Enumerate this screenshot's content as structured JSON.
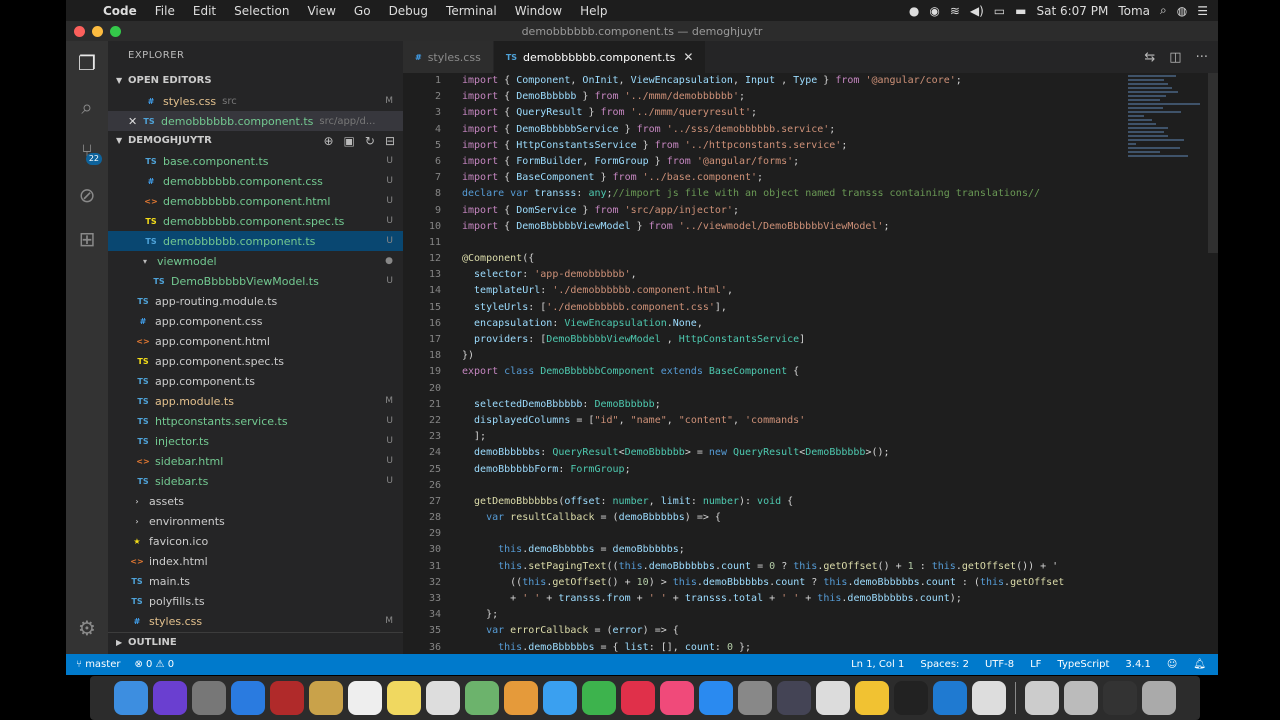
{
  "menubar": {
    "apple": "",
    "items": [
      "Code",
      "File",
      "Edit",
      "Selection",
      "View",
      "Go",
      "Debug",
      "Terminal",
      "Window",
      "Help"
    ],
    "clock": "Sat 6:07 PM",
    "user": "Toma"
  },
  "window": {
    "title": "demobbbbbb.component.ts — demoghjuytr"
  },
  "activity": {
    "scm_badge": "22"
  },
  "explorer": {
    "title": "EXPLORER",
    "open_editors_label": "OPEN EDITORS",
    "open_editors": [
      {
        "icon": "#",
        "name": "styles.css",
        "path": "src",
        "status": "M"
      },
      {
        "icon": "TS",
        "name": "demobbbbbb.component.ts",
        "path": "src/app/d...",
        "status": "U"
      }
    ],
    "project_label": "DEMOGHJUYTR",
    "files": [
      {
        "icon": "TS",
        "name": "base.component.ts",
        "status": "U"
      },
      {
        "icon": "#",
        "name": "demobbbbbb.component.css",
        "status": "U"
      },
      {
        "icon": "<>",
        "name": "demobbbbbb.component.html",
        "status": "U"
      },
      {
        "icon": "TS",
        "name": "demobbbbbb.component.spec.ts",
        "status": "U"
      },
      {
        "icon": "TS",
        "name": "demobbbbbb.component.ts",
        "status": "U"
      },
      {
        "icon": "▾",
        "name": "viewmodel",
        "status": "●"
      },
      {
        "icon": "TS",
        "name": "DemoBbbbbbViewModel.ts",
        "status": "U"
      },
      {
        "icon": "TS",
        "name": "app-routing.module.ts",
        "status": ""
      },
      {
        "icon": "#",
        "name": "app.component.css",
        "status": ""
      },
      {
        "icon": "<>",
        "name": "app.component.html",
        "status": ""
      },
      {
        "icon": "TS",
        "name": "app.component.spec.ts",
        "status": ""
      },
      {
        "icon": "TS",
        "name": "app.component.ts",
        "status": ""
      },
      {
        "icon": "TS",
        "name": "app.module.ts",
        "status": "M"
      },
      {
        "icon": "TS",
        "name": "httpconstants.service.ts",
        "status": "U"
      },
      {
        "icon": "TS",
        "name": "injector.ts",
        "status": "U"
      },
      {
        "icon": "<>",
        "name": "sidebar.html",
        "status": "U"
      },
      {
        "icon": "TS",
        "name": "sidebar.ts",
        "status": "U"
      },
      {
        "icon": "›",
        "name": "assets",
        "status": ""
      },
      {
        "icon": "›",
        "name": "environments",
        "status": ""
      },
      {
        "icon": "★",
        "name": "favicon.ico",
        "status": ""
      },
      {
        "icon": "<>",
        "name": "index.html",
        "status": ""
      },
      {
        "icon": "TS",
        "name": "main.ts",
        "status": ""
      },
      {
        "icon": "TS",
        "name": "polyfills.ts",
        "status": ""
      },
      {
        "icon": "#",
        "name": "styles.css",
        "status": "M"
      }
    ],
    "outline_label": "OUTLINE"
  },
  "tabs": [
    {
      "icon": "#",
      "label": "styles.css"
    },
    {
      "icon": "TS",
      "label": "demobbbbbb.component.ts"
    }
  ],
  "code": {
    "line_numbers": [
      "1",
      "2",
      "3",
      "4",
      "5",
      "6",
      "7",
      "8",
      "9",
      "10",
      "11",
      "12",
      "13",
      "14",
      "15",
      "16",
      "17",
      "18",
      "19",
      "20",
      "21",
      "22",
      "23",
      "24",
      "25",
      "26",
      "27",
      "28",
      "29",
      "30",
      "31",
      "32",
      "33",
      "34",
      "35",
      "36"
    ],
    "lines": [
      [
        [
          "kw",
          "import"
        ],
        [
          "pl",
          " { "
        ],
        [
          "vr",
          "Component"
        ],
        [
          "pl",
          ", "
        ],
        [
          "vr",
          "OnInit"
        ],
        [
          "pl",
          ", "
        ],
        [
          "vr",
          "ViewEncapsulation"
        ],
        [
          "pl",
          ", "
        ],
        [
          "vr",
          "Input"
        ],
        [
          "pl",
          " , "
        ],
        [
          "vr",
          "Type"
        ],
        [
          "pl",
          " } "
        ],
        [
          "kw",
          "from"
        ],
        [
          "str",
          " '@angular/core'"
        ],
        [
          "pl",
          ";"
        ]
      ],
      [
        [
          "kw",
          "import"
        ],
        [
          "pl",
          " { "
        ],
        [
          "vr",
          "DemoBbbbbb"
        ],
        [
          "pl",
          " } "
        ],
        [
          "kw",
          "from"
        ],
        [
          "str",
          " '../mmm/demobbbbbb'"
        ],
        [
          "pl",
          ";"
        ]
      ],
      [
        [
          "kw",
          "import"
        ],
        [
          "pl",
          " { "
        ],
        [
          "vr",
          "QueryResult"
        ],
        [
          "pl",
          " } "
        ],
        [
          "kw",
          "from"
        ],
        [
          "str",
          " '../mmm/queryresult'"
        ],
        [
          "pl",
          ";"
        ]
      ],
      [
        [
          "kw",
          "import"
        ],
        [
          "pl",
          " { "
        ],
        [
          "vr",
          "DemoBbbbbbService"
        ],
        [
          "pl",
          " } "
        ],
        [
          "kw",
          "from"
        ],
        [
          "str",
          " '../sss/demobbbbbb.service'"
        ],
        [
          "pl",
          ";"
        ]
      ],
      [
        [
          "kw",
          "import"
        ],
        [
          "pl",
          " { "
        ],
        [
          "vr",
          "HttpConstantsService"
        ],
        [
          "pl",
          " } "
        ],
        [
          "kw",
          "from"
        ],
        [
          "str",
          " '../httpconstants.service'"
        ],
        [
          "pl",
          ";"
        ]
      ],
      [
        [
          "kw",
          "import"
        ],
        [
          "pl",
          " { "
        ],
        [
          "vr",
          "FormBuilder"
        ],
        [
          "pl",
          ", "
        ],
        [
          "vr",
          "FormGroup"
        ],
        [
          "pl",
          " } "
        ],
        [
          "kw",
          "from"
        ],
        [
          "str",
          " '@angular/forms'"
        ],
        [
          "pl",
          ";"
        ]
      ],
      [
        [
          "kw",
          "import"
        ],
        [
          "pl",
          " { "
        ],
        [
          "vr",
          "BaseComponent"
        ],
        [
          "pl",
          " } "
        ],
        [
          "kw",
          "from"
        ],
        [
          "str",
          " '../base.component'"
        ],
        [
          "pl",
          ";"
        ]
      ],
      [
        [
          "kw2",
          "declare"
        ],
        [
          "kw2",
          " var"
        ],
        [
          "vr",
          " transss"
        ],
        [
          "pl",
          ": "
        ],
        [
          "ty",
          "any"
        ],
        [
          "pl",
          ";"
        ],
        [
          "cm",
          "//import js file with an object named transss containing translations//"
        ]
      ],
      [
        [
          "kw",
          "import"
        ],
        [
          "pl",
          " { "
        ],
        [
          "vr",
          "DomService"
        ],
        [
          "pl",
          " } "
        ],
        [
          "kw",
          "from"
        ],
        [
          "str",
          " 'src/app/injector'"
        ],
        [
          "pl",
          ";"
        ]
      ],
      [
        [
          "kw",
          "import"
        ],
        [
          "pl",
          " { "
        ],
        [
          "vr",
          "DemoBbbbbbViewModel"
        ],
        [
          "pl",
          " } "
        ],
        [
          "kw",
          "from"
        ],
        [
          "str",
          " '../viewmodel/DemoBbbbbbViewModel'"
        ],
        [
          "pl",
          ";"
        ]
      ],
      [
        [
          "pl",
          ""
        ]
      ],
      [
        [
          "fn",
          "@Component"
        ],
        [
          "pl",
          "({"
        ]
      ],
      [
        [
          "vr",
          "  selector"
        ],
        [
          "pl",
          ": "
        ],
        [
          "str",
          "'app-demobbbbbb'"
        ],
        [
          "pl",
          ","
        ]
      ],
      [
        [
          "vr",
          "  templateUrl"
        ],
        [
          "pl",
          ": "
        ],
        [
          "str",
          "'./demobbbbbb.component.html'"
        ],
        [
          "pl",
          ","
        ]
      ],
      [
        [
          "vr",
          "  styleUrls"
        ],
        [
          "pl",
          ": ["
        ],
        [
          "str",
          "'./demobbbbbb.component.css'"
        ],
        [
          "pl",
          "],"
        ]
      ],
      [
        [
          "vr",
          "  encapsulation"
        ],
        [
          "pl",
          ": "
        ],
        [
          "ty",
          "ViewEncapsulation"
        ],
        [
          "pl",
          "."
        ],
        [
          "vr",
          "None"
        ],
        [
          "pl",
          ","
        ]
      ],
      [
        [
          "vr",
          "  providers"
        ],
        [
          "pl",
          ": ["
        ],
        [
          "ty",
          "DemoBbbbbbViewModel"
        ],
        [
          "pl",
          " , "
        ],
        [
          "ty",
          "HttpConstantsService"
        ],
        [
          "pl",
          "]"
        ]
      ],
      [
        [
          "pl",
          "})"
        ]
      ],
      [
        [
          "kw",
          "export"
        ],
        [
          "kw2",
          " class"
        ],
        [
          "ty",
          " DemoBbbbbbComponent"
        ],
        [
          "kw2",
          " extends"
        ],
        [
          "ty",
          " BaseComponent"
        ],
        [
          "pl",
          " {"
        ]
      ],
      [
        [
          "pl",
          ""
        ]
      ],
      [
        [
          "vr",
          "  selectedDemoBbbbbb"
        ],
        [
          "pl",
          ": "
        ],
        [
          "ty",
          "DemoBbbbbb"
        ],
        [
          "pl",
          ";"
        ]
      ],
      [
        [
          "vr",
          "  displayedColumns"
        ],
        [
          "pl",
          " = ["
        ],
        [
          "str",
          "\"id\""
        ],
        [
          "pl",
          ", "
        ],
        [
          "str",
          "\"name\""
        ],
        [
          "pl",
          ", "
        ],
        [
          "str",
          "\"content\""
        ],
        [
          "pl",
          ", "
        ],
        [
          "str",
          "'commands'"
        ]
      ],
      [
        [
          "pl",
          "  ];"
        ]
      ],
      [
        [
          "vr",
          "  demoBbbbbbs"
        ],
        [
          "pl",
          ": "
        ],
        [
          "ty",
          "QueryResult"
        ],
        [
          "pl",
          "<"
        ],
        [
          "ty",
          "DemoBbbbbb"
        ],
        [
          "pl",
          "> = "
        ],
        [
          "kw2",
          "new"
        ],
        [
          "ty",
          " QueryResult"
        ],
        [
          "pl",
          "<"
        ],
        [
          "ty",
          "DemoBbbbbb"
        ],
        [
          "pl",
          ">();"
        ]
      ],
      [
        [
          "vr",
          "  demoBbbbbbForm"
        ],
        [
          "pl",
          ": "
        ],
        [
          "ty",
          "FormGroup"
        ],
        [
          "pl",
          ";"
        ]
      ],
      [
        [
          "pl",
          ""
        ]
      ],
      [
        [
          "fn",
          "  getDemoBbbbbbs"
        ],
        [
          "pl",
          "("
        ],
        [
          "vr",
          "offset"
        ],
        [
          "pl",
          ": "
        ],
        [
          "ty",
          "number"
        ],
        [
          "pl",
          ", "
        ],
        [
          "vr",
          "limit"
        ],
        [
          "pl",
          ": "
        ],
        [
          "ty",
          "number"
        ],
        [
          "pl",
          "): "
        ],
        [
          "ty",
          "void"
        ],
        [
          "pl",
          " {"
        ]
      ],
      [
        [
          "kw2",
          "    var"
        ],
        [
          "fn",
          " resultCallback"
        ],
        [
          "pl",
          " = ("
        ],
        [
          "vr",
          "demoBbbbbbs"
        ],
        [
          "pl",
          ") => {"
        ]
      ],
      [
        [
          "pl",
          ""
        ]
      ],
      [
        [
          "kw2",
          "      this"
        ],
        [
          "pl",
          "."
        ],
        [
          "vr",
          "demoBbbbbbs"
        ],
        [
          "pl",
          " = "
        ],
        [
          "vr",
          "demoBbbbbbs"
        ],
        [
          "pl",
          ";"
        ]
      ],
      [
        [
          "kw2",
          "      this"
        ],
        [
          "pl",
          "."
        ],
        [
          "fn",
          "setPagingText"
        ],
        [
          "pl",
          "(("
        ],
        [
          "kw2",
          "this"
        ],
        [
          "pl",
          "."
        ],
        [
          "vr",
          "demoBbbbbbs"
        ],
        [
          "pl",
          "."
        ],
        [
          "vr",
          "count"
        ],
        [
          "pl",
          " = "
        ],
        [
          "nm",
          "0"
        ],
        [
          "pl",
          " ? "
        ],
        [
          "kw2",
          "this"
        ],
        [
          "pl",
          "."
        ],
        [
          "fn",
          "getOffset"
        ],
        [
          "pl",
          "() + "
        ],
        [
          "nm",
          "1"
        ],
        [
          "pl",
          " : "
        ],
        [
          "kw2",
          "this"
        ],
        [
          "pl",
          "."
        ],
        [
          "fn",
          "getOffset"
        ],
        [
          "pl",
          "()) + '"
        ]
      ],
      [
        [
          "pl",
          "        (("
        ],
        [
          "kw2",
          "this"
        ],
        [
          "pl",
          "."
        ],
        [
          "fn",
          "getOffset"
        ],
        [
          "pl",
          "() + "
        ],
        [
          "nm",
          "10"
        ],
        [
          "pl",
          ") > "
        ],
        [
          "kw2",
          "this"
        ],
        [
          "pl",
          "."
        ],
        [
          "vr",
          "demoBbbbbbs"
        ],
        [
          "pl",
          "."
        ],
        [
          "vr",
          "count"
        ],
        [
          "pl",
          " ? "
        ],
        [
          "kw2",
          "this"
        ],
        [
          "pl",
          "."
        ],
        [
          "vr",
          "demoBbbbbbs"
        ],
        [
          "pl",
          "."
        ],
        [
          "vr",
          "count"
        ],
        [
          "pl",
          " : ("
        ],
        [
          "kw2",
          "this"
        ],
        [
          "pl",
          "."
        ],
        [
          "fn",
          "getOffset"
        ]
      ],
      [
        [
          "pl",
          "        + "
        ],
        [
          "str",
          "' '"
        ],
        [
          "pl",
          " + "
        ],
        [
          "vr",
          "transss"
        ],
        [
          "pl",
          "."
        ],
        [
          "vr",
          "from"
        ],
        [
          "pl",
          " + "
        ],
        [
          "str",
          "' '"
        ],
        [
          "pl",
          " + "
        ],
        [
          "vr",
          "transss"
        ],
        [
          "pl",
          "."
        ],
        [
          "vr",
          "total"
        ],
        [
          "pl",
          " + "
        ],
        [
          "str",
          "' '"
        ],
        [
          "pl",
          " + "
        ],
        [
          "kw2",
          "this"
        ],
        [
          "pl",
          "."
        ],
        [
          "vr",
          "demoBbbbbbs"
        ],
        [
          "pl",
          "."
        ],
        [
          "vr",
          "count"
        ],
        [
          "pl",
          ");"
        ]
      ],
      [
        [
          "pl",
          "    };"
        ]
      ],
      [
        [
          "kw2",
          "    var"
        ],
        [
          "fn",
          " errorCallback"
        ],
        [
          "pl",
          " = ("
        ],
        [
          "vr",
          "error"
        ],
        [
          "pl",
          ") => {"
        ]
      ],
      [
        [
          "kw2",
          "      this"
        ],
        [
          "pl",
          "."
        ],
        [
          "vr",
          "demoBbbbbbs"
        ],
        [
          "pl",
          " = { "
        ],
        [
          "vr",
          "list"
        ],
        [
          "pl",
          ": [], "
        ],
        [
          "vr",
          "count"
        ],
        [
          "pl",
          ": "
        ],
        [
          "nm",
          "0"
        ],
        [
          "pl",
          " };"
        ]
      ]
    ]
  },
  "statusbar": {
    "branch": "master",
    "problems": "⊗ 0 ⚠ 0",
    "position": "Ln 1, Col 1",
    "spaces": "Spaces: 2",
    "encoding": "UTF-8",
    "eol": "LF",
    "language": "TypeScript",
    "version": "3.4.1"
  },
  "dock": [
    "finder-icon",
    "siri-icon",
    "launchpad-icon",
    "safari-icon",
    "photo-booth-icon",
    "notes-icon",
    "calendar-icon",
    "stickies-icon",
    "textedit-icon",
    "maps-icon",
    "photos-icon",
    "messages-icon",
    "facetime-icon",
    "news-icon",
    "music-icon",
    "app-store-icon",
    "system-preferences-icon",
    "xcode-icon",
    "chrome-icon",
    "chrome-canary-icon",
    "terminal-icon",
    "vscode-icon",
    "stuffit-icon",
    "downloads-stack-icon",
    "documents-stack-icon",
    "screen-icon",
    "trash-icon"
  ]
}
